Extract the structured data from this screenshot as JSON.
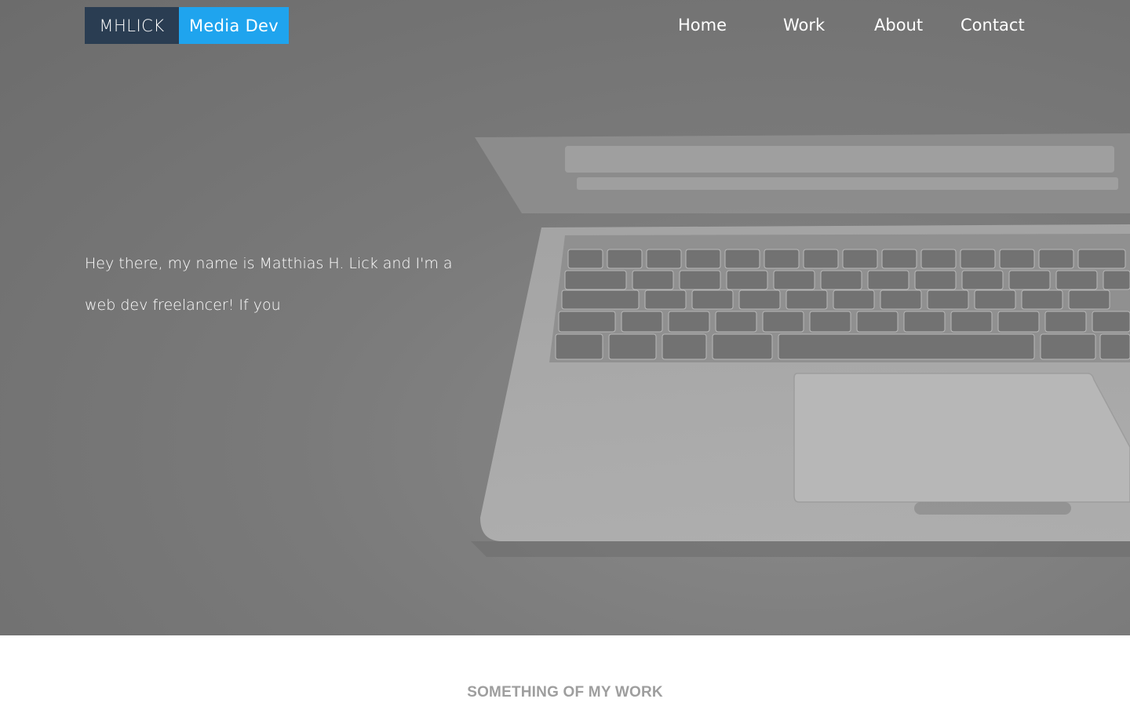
{
  "brand": {
    "name": "MHLICK",
    "tagline": "Media Dev",
    "colors": {
      "dark": "#2a3d52",
      "accent": "#1fa4ee"
    }
  },
  "nav": {
    "items": [
      {
        "label": "Home"
      },
      {
        "label": "Work"
      },
      {
        "label": "About"
      },
      {
        "label": "Contact"
      }
    ]
  },
  "hero": {
    "intro": "Hey there, my name is Matthias H. Lick and I'm a web dev freelancer! If you",
    "background_image": "laptop-keyboard-photo"
  },
  "work_section": {
    "title": "SOMETHING OF MY WORK"
  }
}
